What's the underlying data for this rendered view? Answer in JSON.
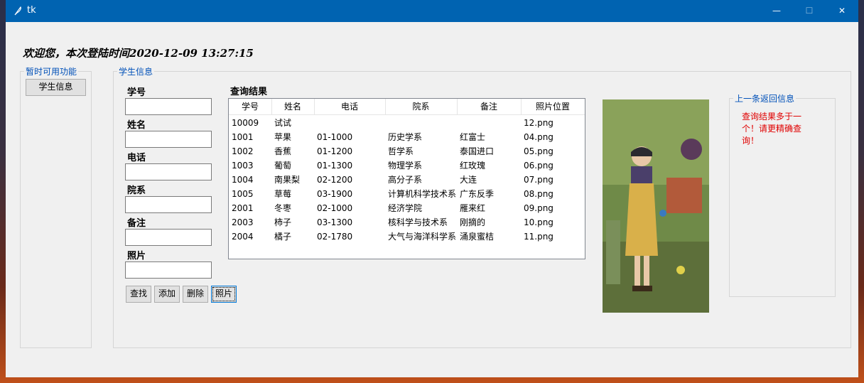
{
  "window": {
    "title": "tk",
    "minimize_glyph": "—",
    "maximize_glyph": "☐",
    "close_glyph": "✕"
  },
  "welcome": "欢迎您，本次登陆时间2020-12-09 13:27:15",
  "left_panel": {
    "title": "暂时可用功能",
    "button": "学生信息"
  },
  "student_panel": {
    "title": "学生信息",
    "fields": [
      {
        "label": "学号",
        "value": ""
      },
      {
        "label": "姓名",
        "value": ""
      },
      {
        "label": "电话",
        "value": ""
      },
      {
        "label": "院系",
        "value": ""
      },
      {
        "label": "备注",
        "value": ""
      },
      {
        "label": "照片",
        "value": ""
      }
    ],
    "buttons": [
      "查找",
      "添加",
      "删除",
      "照片"
    ]
  },
  "results": {
    "title": "查询结果",
    "columns": [
      "学号",
      "姓名",
      "电话",
      "院系",
      "备注",
      "照片位置"
    ],
    "rows": [
      [
        "10009",
        "试试",
        "",
        "",
        "",
        "12.png"
      ],
      [
        "1001",
        "苹果",
        "01-1000",
        "历史学系",
        "红富士",
        "04.png"
      ],
      [
        "1002",
        "香蕉",
        "01-1200",
        "哲学系",
        "泰国进口",
        "05.png"
      ],
      [
        "1003",
        "葡萄",
        "01-1300",
        "物理学系",
        "红玫瑰",
        "06.png"
      ],
      [
        "1004",
        "南果梨",
        "02-1200",
        "高分子系",
        "大连",
        "07.png"
      ],
      [
        "1005",
        "草莓",
        "03-1900",
        "计算机科学技术系",
        "广东反季",
        "08.png"
      ],
      [
        "2001",
        "冬枣",
        "02-1000",
        "经济学院",
        "雁来红",
        "09.png"
      ],
      [
        "2003",
        "柿子",
        "03-1300",
        "核科学与技术系",
        "刚摘的",
        "10.png"
      ],
      [
        "2004",
        "橘子",
        "02-1780",
        "大气与海洋科学系",
        "涌泉蜜桔",
        "11.png"
      ]
    ]
  },
  "last_info": {
    "title": "上一条返回信息",
    "message": "查询结果多于一个！请更精确查询！"
  },
  "colors": {
    "titlebar": "#0063b1",
    "legend": "#0050b8",
    "error": "#e00000"
  }
}
